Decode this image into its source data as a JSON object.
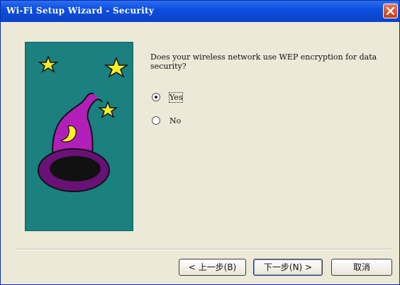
{
  "window": {
    "title": "Wi-Fi Setup Wizard - Security"
  },
  "question": "Does your wireless network use WEP encryption for data security?",
  "options": [
    {
      "label": "Yes",
      "selected": true
    },
    {
      "label": "No",
      "selected": false
    }
  ],
  "buttons": {
    "back": "< 上一步(B)",
    "next": "下一步(N) >",
    "cancel": "取消"
  },
  "colors": {
    "titlebar": "#0a43c8",
    "art_background": "#1a8080",
    "hat": "#b21fb8",
    "star": "#ffee22"
  },
  "icons": [
    "close-icon",
    "wizard-hat-icon",
    "star-icon"
  ]
}
